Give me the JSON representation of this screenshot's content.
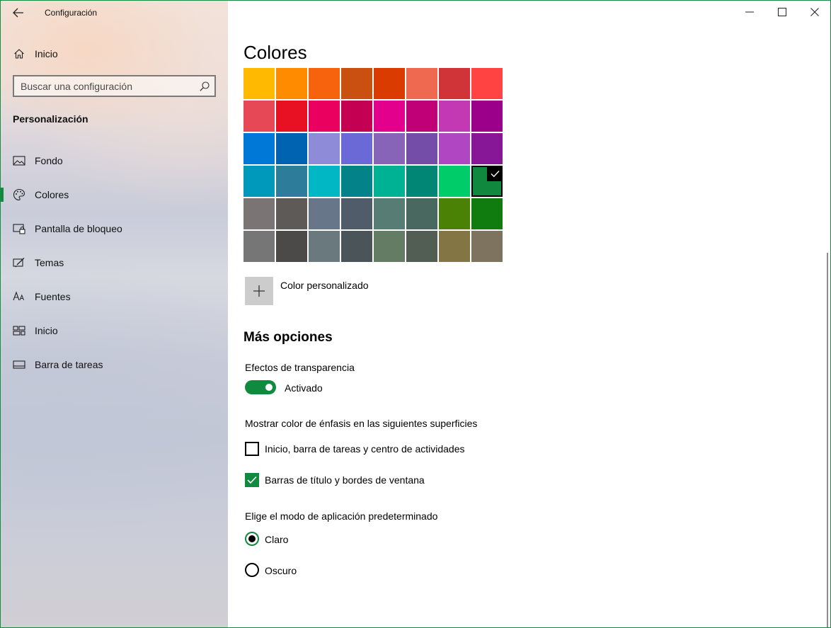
{
  "window": {
    "title": "Configuración"
  },
  "sidebar": {
    "home_label": "Inicio",
    "search_placeholder": "Buscar una configuración",
    "section_heading": "Personalización",
    "items": [
      {
        "label": "Fondo",
        "icon": "image-icon",
        "active": false
      },
      {
        "label": "Colores",
        "icon": "palette-icon",
        "active": true
      },
      {
        "label": "Pantalla de bloqueo",
        "icon": "lock-screen-icon",
        "active": false
      },
      {
        "label": "Temas",
        "icon": "themes-icon",
        "active": false
      },
      {
        "label": "Fuentes",
        "icon": "fonts-icon",
        "active": false
      },
      {
        "label": "Inicio",
        "icon": "start-icon",
        "active": false
      },
      {
        "label": "Barra de tareas",
        "icon": "taskbar-icon",
        "active": false
      }
    ]
  },
  "main": {
    "title": "Colores",
    "swatches": [
      "#ffb900",
      "#ff8c00",
      "#f7630c",
      "#ca5010",
      "#da3b01",
      "#ef6950",
      "#d13438",
      "#ff4343",
      "#e74856",
      "#e81123",
      "#ea005e",
      "#c30052",
      "#e3008c",
      "#bf0077",
      "#c239b3",
      "#9a0089",
      "#0078d7",
      "#0063b1",
      "#8e8cd8",
      "#6b69d6",
      "#8764b8",
      "#744da9",
      "#b146c2",
      "#881798",
      "#0099bc",
      "#2d7d9a",
      "#00b7c3",
      "#038387",
      "#00b294",
      "#018574",
      "#00cc6a",
      "#10893e",
      "#7a7574",
      "#5d5a58",
      "#68768a",
      "#515c6b",
      "#567c73",
      "#486860",
      "#498205",
      "#107c10",
      "#767676",
      "#4c4a48",
      "#69797e",
      "#4a5459",
      "#647c64",
      "#525e54",
      "#847545",
      "#7e735f"
    ],
    "selected_swatch_index": 31,
    "custom_color_label": "Color personalizado",
    "more_options_title": "Más opciones",
    "transparency": {
      "label": "Efectos de transparencia",
      "state_label": "Activado",
      "on": true
    },
    "accent_surfaces": {
      "label": "Mostrar color de énfasis en las siguientes superficies",
      "options": [
        {
          "label": "Inicio, barra de tareas y centro de actividades",
          "checked": false
        },
        {
          "label": "Barras de título y bordes de ventana",
          "checked": true
        }
      ]
    },
    "app_mode": {
      "label": "Elige el modo de aplicación predeterminado",
      "options": [
        {
          "label": "Claro",
          "selected": true
        },
        {
          "label": "Oscuro",
          "selected": false
        }
      ]
    }
  },
  "colors": {
    "accent": "#108a3e",
    "window_border": "#1a8a40"
  }
}
